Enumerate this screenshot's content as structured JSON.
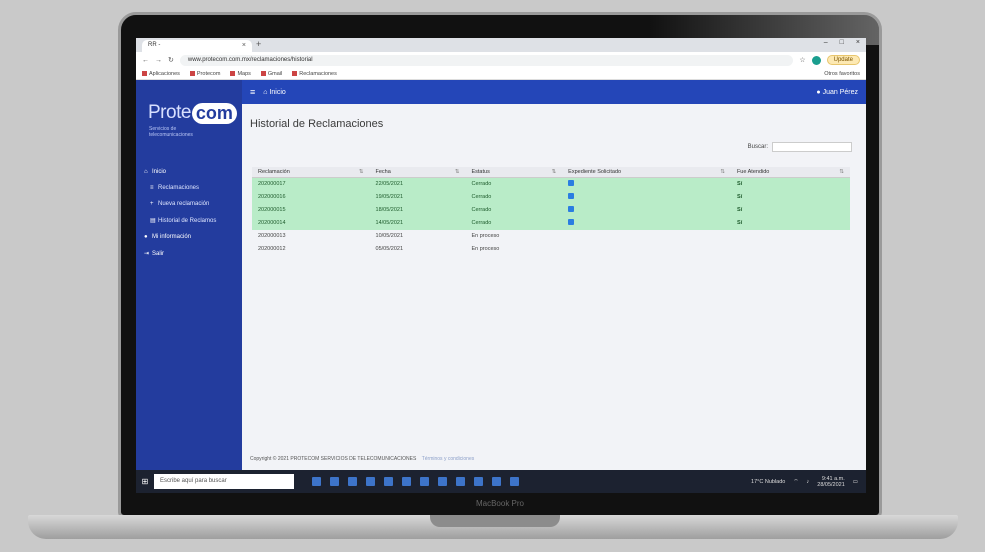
{
  "browser": {
    "tab_title": "RR - ",
    "url": "www.protecom.com.mx/reclamaciones/historial",
    "update_label": "Update",
    "bookmarks": [
      "Aplicaciones",
      "Protecom",
      "Maps",
      "Gmail",
      "Reclamaciones"
    ],
    "bookmarks_right": "Otros favoritos"
  },
  "sidebar": {
    "logo_left": "Prote",
    "logo_right": "com",
    "logo_tagline": "Servicios de telecomunicaciones",
    "items": [
      {
        "label": "Inicio",
        "icon": "home-icon"
      },
      {
        "label": "Reclamaciones",
        "icon": "list-icon"
      },
      {
        "label": "Nueva reclamación",
        "icon": "plus-icon"
      },
      {
        "label": "Historial de Reclamos",
        "icon": "history-icon"
      },
      {
        "label": "Mi información",
        "icon": "user-icon"
      },
      {
        "label": "Salir",
        "icon": "logout-icon"
      }
    ]
  },
  "topbar": {
    "menu_icon": "hamburger-icon",
    "home_label": "Inicio",
    "user_label": "Juan Pérez"
  },
  "page": {
    "title": "Historial de Reclamaciones",
    "search_label": "Buscar:",
    "search_placeholder": ""
  },
  "table": {
    "headers": [
      "Reclamación",
      "Fecha",
      "Estatus",
      "Expediente Solicitado",
      "Fue Atendido"
    ],
    "rows": [
      {
        "id": "202000017",
        "date": "22/05/2021",
        "status": "Cerrado",
        "expediente": true,
        "atendido": "Sí"
      },
      {
        "id": "202000016",
        "date": "19/05/2021",
        "status": "Cerrado",
        "expediente": true,
        "atendido": "Sí"
      },
      {
        "id": "202000015",
        "date": "18/05/2021",
        "status": "Cerrado",
        "expediente": true,
        "atendido": "Sí"
      },
      {
        "id": "202000014",
        "date": "14/05/2021",
        "status": "Cerrado",
        "expediente": true,
        "atendido": "Sí"
      },
      {
        "id": "202000013",
        "date": "10/05/2021",
        "status": "En proceso",
        "expediente": false,
        "atendido": ""
      },
      {
        "id": "202000012",
        "date": "05/05/2021",
        "status": "En proceso",
        "expediente": false,
        "atendido": ""
      }
    ]
  },
  "footer": {
    "copyright": "Copyright © 2021 PROTECOM SERVICIOS DE TELECOMUNICACIONES",
    "link": "Términos y condiciones"
  },
  "taskbar": {
    "search_placeholder": "Escribe aquí para buscar",
    "tray": "17°C  Nublado",
    "time": "9:41 a.m.",
    "date": "28/05/2021"
  },
  "laptop_brand": "MacBook Pro",
  "colors": {
    "sidebar": "#233c9e",
    "topbar": "#2446b8",
    "closed_row": "#b9ecc8",
    "accent": "#2a7de1"
  }
}
